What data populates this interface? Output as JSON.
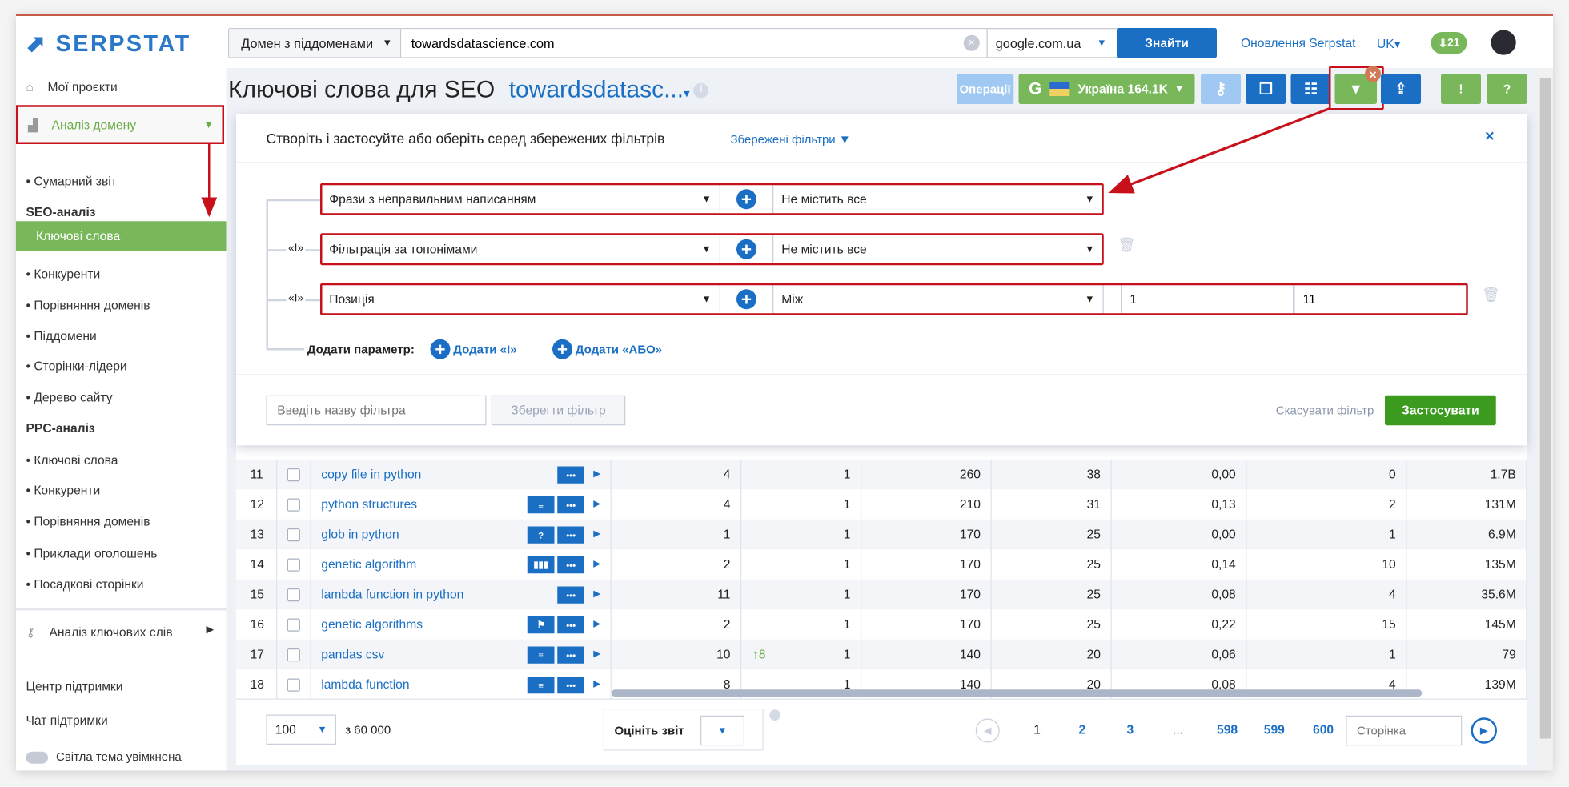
{
  "header": {
    "logo": "SERPSTAT",
    "search_type": "Домен з піддоменами",
    "search_value": "towardsdatascience.com",
    "engine": "google.com.ua",
    "search_button": "Знайти",
    "updates_link": "Оновлення Serpstat",
    "language": "UK",
    "downloads_count": "21"
  },
  "sidebar": {
    "my_projects": "Мої проєкти",
    "domain_analysis": "Аналіз домену",
    "items": [
      {
        "label": "Сумарний звіт",
        "type": "item"
      },
      {
        "label": "SEO-аналіз",
        "type": "section"
      },
      {
        "label": "Ключові слова",
        "type": "active"
      },
      {
        "label": "Конкуренти",
        "type": "item"
      },
      {
        "label": "Порівняння доменів",
        "type": "item"
      },
      {
        "label": "Піддомени",
        "type": "item"
      },
      {
        "label": "Сторінки-лідери",
        "type": "item"
      },
      {
        "label": "Дерево сайту",
        "type": "item"
      },
      {
        "label": "PPC-аналіз",
        "type": "section"
      },
      {
        "label": "Ключові слова",
        "type": "item"
      },
      {
        "label": "Конкуренти",
        "type": "item"
      },
      {
        "label": "Порівняння доменів",
        "type": "item"
      },
      {
        "label": "Приклади оголошень",
        "type": "item"
      },
      {
        "label": "Посадкові сторінки",
        "type": "item"
      }
    ],
    "keyword_analysis": "Аналіз ключових слів",
    "support_center": "Центр підтримки",
    "support_chat": "Чат підтримки",
    "light_theme": "Світла тема увімкнена"
  },
  "page": {
    "title": "Ключові слова для SEO",
    "domain": "towardsdatasc...",
    "toolbar": {
      "operations": "Операції",
      "region": "Україна 164.1K",
      "engine_letter": "G"
    }
  },
  "filter": {
    "heading": "Створіть і застосуйте або оберіть серед збережених фільтрів",
    "saved_filters": "Збережені фільтри",
    "close": "×",
    "rows": [
      {
        "connector": "",
        "param": "Фрази з неправильним написанням",
        "condition": "Не містить все"
      },
      {
        "connector": "«І»",
        "param": "Фільтрація за топонімами",
        "condition": "Не містить все"
      },
      {
        "connector": "«І»",
        "param": "Позиція",
        "condition": "Між",
        "from": "1",
        "to": "11"
      }
    ],
    "add_param_label": "Додати параметр:",
    "add_and": "Додати «І»",
    "add_or": "Додати «АБО»",
    "name_placeholder": "Введіть назву фільтра",
    "save_button": "Зберегти фільтр",
    "cancel": "Скасувати фільтр",
    "apply": "Застосувати"
  },
  "table": {
    "rows": [
      {
        "n": "11",
        "kw": "copy file in python",
        "icons": [
          "dots"
        ],
        "c1": "4",
        "trend": "",
        "c2": "1",
        "c3": "260",
        "c4": "38",
        "c5": "0,00",
        "c6": "0",
        "c7": "1.7B"
      },
      {
        "n": "12",
        "kw": "python structures",
        "icons": [
          "lines",
          "dots"
        ],
        "c1": "4",
        "trend": "",
        "c2": "1",
        "c3": "210",
        "c4": "31",
        "c5": "0,13",
        "c6": "2",
        "c7": "131M"
      },
      {
        "n": "13",
        "kw": "glob in python",
        "icons": [
          "question",
          "dots"
        ],
        "c1": "1",
        "trend": "",
        "c2": "1",
        "c3": "170",
        "c4": "25",
        "c5": "0,00",
        "c6": "1",
        "c7": "6.9M"
      },
      {
        "n": "14",
        "kw": "genetic algorithm",
        "icons": [
          "bars",
          "dots"
        ],
        "c1": "2",
        "trend": "",
        "c2": "1",
        "c3": "170",
        "c4": "25",
        "c5": "0,14",
        "c6": "10",
        "c7": "135M"
      },
      {
        "n": "15",
        "kw": "lambda function in python",
        "icons": [
          "dots"
        ],
        "c1": "11",
        "trend": "",
        "c2": "1",
        "c3": "170",
        "c4": "25",
        "c5": "0,08",
        "c6": "4",
        "c7": "35.6M"
      },
      {
        "n": "16",
        "kw": "genetic algorithms",
        "icons": [
          "flag",
          "dots"
        ],
        "c1": "2",
        "trend": "",
        "c2": "1",
        "c3": "170",
        "c4": "25",
        "c5": "0,22",
        "c6": "15",
        "c7": "145M"
      },
      {
        "n": "17",
        "kw": "pandas csv",
        "icons": [
          "lines",
          "dots"
        ],
        "c1": "10",
        "trend": "↑8",
        "c2": "1",
        "c3": "140",
        "c4": "20",
        "c5": "0,06",
        "c6": "1",
        "c7": "79"
      },
      {
        "n": "18",
        "kw": "lambda function",
        "icons": [
          "lines",
          "dots"
        ],
        "c1": "8",
        "trend": "",
        "c2": "1",
        "c3": "140",
        "c4": "20",
        "c5": "0,08",
        "c6": "4",
        "c7": "139M"
      }
    ]
  },
  "footer": {
    "per_page": "100",
    "total": "з 60 000",
    "rate_report": "Оцініть звіт",
    "pages": [
      "1",
      "2",
      "3",
      "...",
      "598",
      "599",
      "600"
    ],
    "page_placeholder": "Сторінка"
  },
  "colors": {
    "brand_blue": "#1a6fc4",
    "green": "#78b85a",
    "apply_green": "#3a9b1f",
    "highlight_red": "#c8101a"
  }
}
